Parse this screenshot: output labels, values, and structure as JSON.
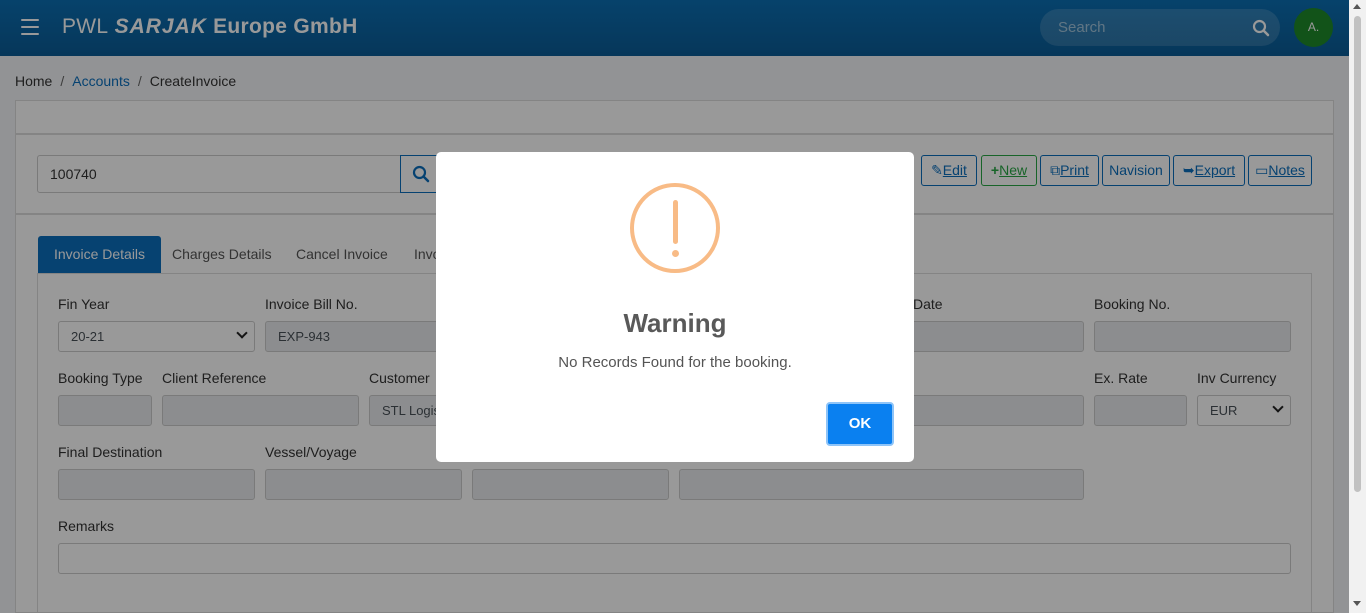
{
  "header": {
    "brand_prefix": "PWL",
    "brand_logo": "SARJAK",
    "brand_suffix": "Europe GmbH",
    "search_placeholder": "Search",
    "avatar_text": "A."
  },
  "breadcrumb": {
    "home": "Home",
    "accounts": "Accounts",
    "current": "CreateInvoice"
  },
  "invoice_search": {
    "value": "100740"
  },
  "toolbar": {
    "edit": "Edit",
    "new": "New",
    "print": "Print",
    "navision": "Navision",
    "export": "Export",
    "notes": "Notes"
  },
  "tabs": [
    "Invoice Details",
    "Charges Details",
    "Cancel Invoice",
    "Invo"
  ],
  "form": {
    "fin_year_label": "Fin Year",
    "fin_year_value": "20-21",
    "invoice_bill_no_label": "Invoice Bill No.",
    "invoice_bill_no_value": "EXP-943",
    "date_label": "Date",
    "booking_no_label": "Booking No.",
    "booking_type_label": "Booking Type",
    "client_reference_label": "Client Reference",
    "customer_label": "Customer",
    "customer_value": "STL Logist",
    "ex_rate_label": "Ex. Rate",
    "inv_currency_label": "Inv Currency",
    "inv_currency_value": "EUR",
    "final_destination_label": "Final Destination",
    "vessel_voyage_label": "Vessel/Voyage",
    "remarks_label": "Remarks"
  },
  "modal": {
    "title": "Warning",
    "message": "No Records Found for the booking.",
    "ok_label": "OK",
    "accent_color": "#f8bb86",
    "button_color": "#0a80f0"
  }
}
